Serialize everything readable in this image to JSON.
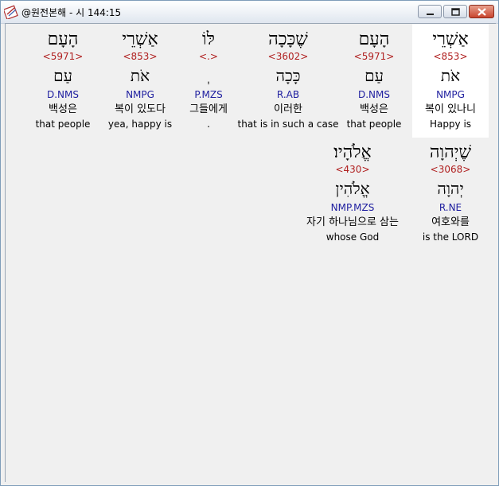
{
  "window": {
    "title": "@원전본해 - 시 144:15"
  },
  "verse": {
    "row1": [
      {
        "hebrew": "אַשְׁרֵי",
        "strong": "<853>",
        "lemma": "אֹת",
        "morph": "NMPG",
        "korean": "복이 있나니",
        "english": "Happy is",
        "selected": true
      },
      {
        "hebrew": "הָעָם",
        "strong": "<5971>",
        "lemma": "עַם",
        "morph": "D.NMS",
        "korean": "백성은",
        "english": "that people",
        "selected": false
      },
      {
        "hebrew": "שֶׁכָּכָה",
        "strong": "<3602>",
        "lemma": "כָּכָה",
        "morph": "R.AB",
        "korean": "이러한",
        "english": "that is in such a case",
        "selected": false
      },
      {
        "hebrew": "לּוֹ",
        "strong": "<.>",
        "lemma": "ְ",
        "morph": "P.MZS",
        "korean": "그들에게",
        "english": ".",
        "selected": false
      },
      {
        "hebrew": "אַשְׁרֵי",
        "strong": "<853>",
        "lemma": "אֹת",
        "morph": "NMPG",
        "korean": "복이 있도다",
        "english": "yea, happy is",
        "selected": false
      },
      {
        "hebrew": "הָעָם",
        "strong": "<5971>",
        "lemma": "עַם",
        "morph": "D.NMS",
        "korean": "백성은",
        "english": "that people",
        "selected": false
      }
    ],
    "row2": [
      {
        "hebrew": "שֶׁיְהוָה",
        "strong": "<3068>",
        "lemma": "יְהוָה",
        "morph": "R.NE",
        "korean": "여호와를",
        "english": "is the LORD",
        "selected": false
      },
      {
        "hebrew": "אֱלֹהָיו׃",
        "strong": "<430>",
        "lemma": "אֱלֹהִין",
        "morph": "NMP.MZS",
        "korean": "자기 하나님으로 삼는",
        "english": "whose God",
        "selected": false
      }
    ]
  },
  "colors": {
    "strong": "#b02020",
    "morph": "#2020a0",
    "selection": "#ffffff"
  }
}
